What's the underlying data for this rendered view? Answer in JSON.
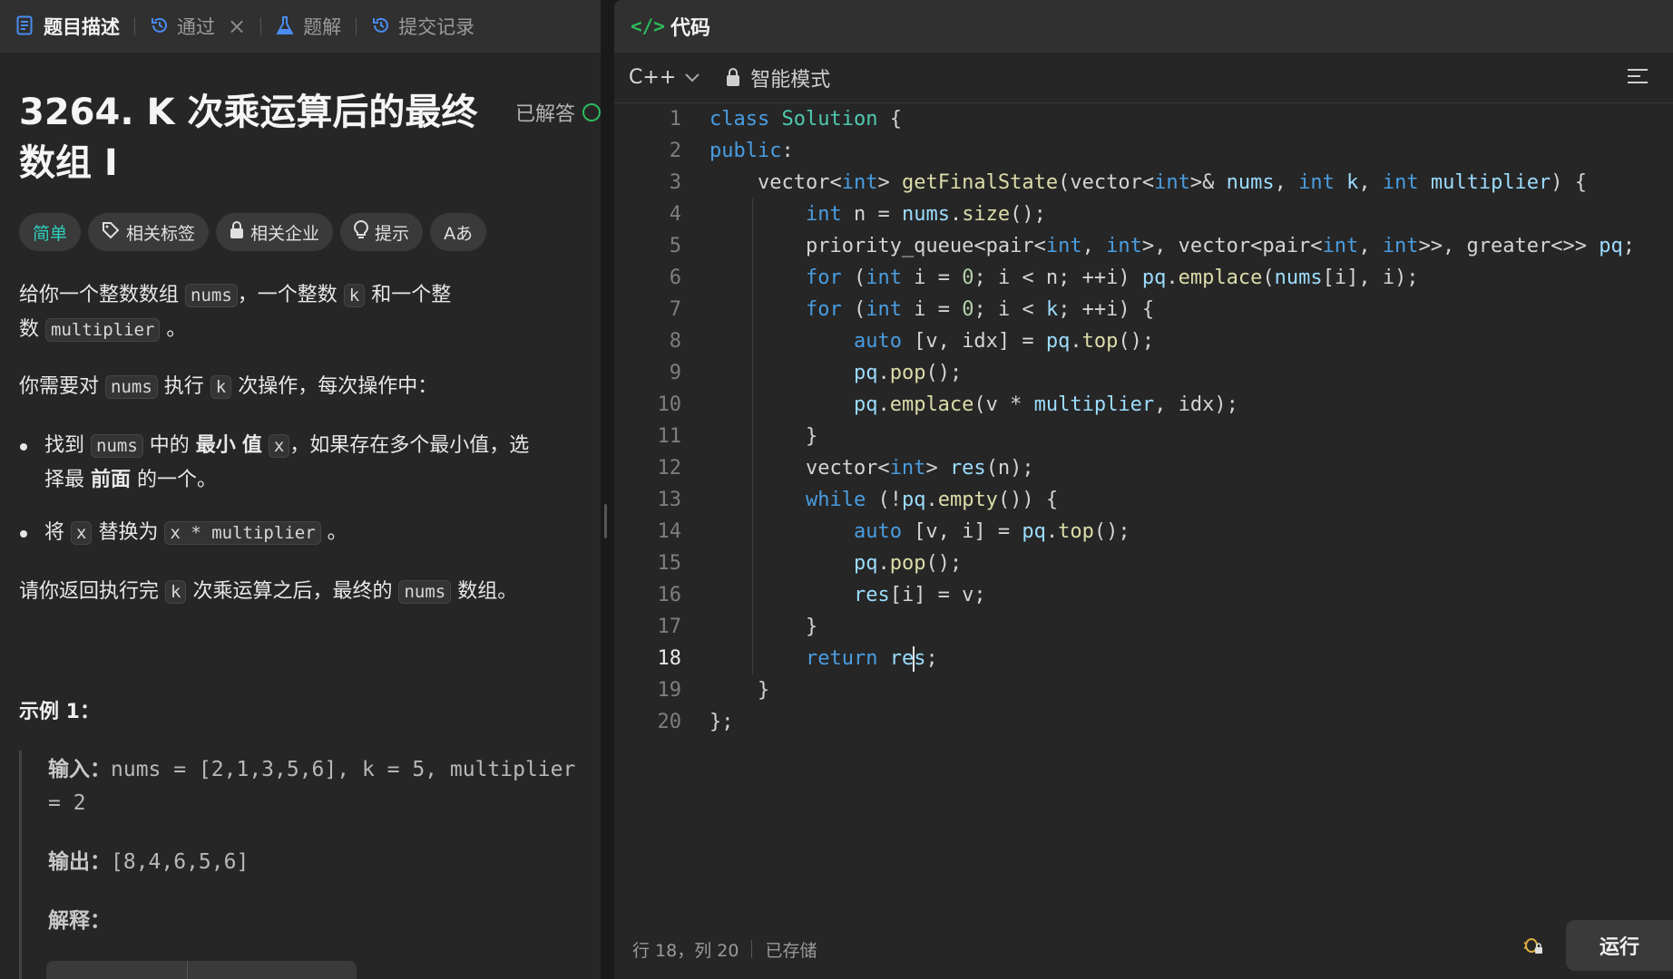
{
  "left_tabs": [
    {
      "label": "题目描述",
      "icon": "document-icon",
      "active": true
    },
    {
      "label": "通过",
      "icon": "history-icon",
      "closable": true
    },
    {
      "label": "题解",
      "icon": "flask-icon"
    },
    {
      "label": "提交记录",
      "icon": "history-icon"
    }
  ],
  "problem": {
    "title": "3264. K 次乘运算后的最终数组 I",
    "solved_label": "已解答",
    "tags": {
      "difficulty": "简单",
      "related_tags": "相关标签",
      "related_companies": "相关企业",
      "hint": "提示",
      "font_toggle": "Aあ"
    },
    "desc": {
      "p1_a": "给你一个整数数组",
      "p1_nums": "nums",
      "p1_b": "，一个整数",
      "p1_k": "k",
      "p1_c": "和一个整",
      "p1_d": "数",
      "p1_mult": "multiplier",
      "p1_e": "。",
      "p2_a": "你需要对",
      "p2_nums": "nums",
      "p2_b": "执行",
      "p2_k": "k",
      "p2_c": "次操作，每次操作中：",
      "b1_a": "找到",
      "b1_nums": "nums",
      "b1_b": "中的",
      "b1_bold1": "最小",
      "b1_bold2": "值",
      "b1_x": "x",
      "b1_c": "，如果存在多个最小值，选",
      "b1_d": "择最",
      "b1_bold3": "前面",
      "b1_e": "的一个。",
      "b2_a": "将",
      "b2_x": "x",
      "b2_b": "替换为",
      "b2_expr": "x * multiplier",
      "b2_c": "。",
      "p3_a": "请你返回执行完",
      "p3_k": "k",
      "p3_b": "次乘运算之后，最终的",
      "p3_nums": "nums",
      "p3_c": "数组。"
    },
    "example": {
      "title": "示例 1：",
      "input_label": "输入：",
      "input_value": "nums = [2,1,3,5,6], k = 5, multiplier",
      "input_cont": "= 2",
      "output_label": "输出：",
      "output_value": "[8,4,6,5,6]",
      "explain_label": "解释："
    }
  },
  "editor": {
    "tab_label": "代码",
    "language": "C++",
    "mode": "智能模式",
    "status_position": "行 18，列 20",
    "status_saved": "已存储",
    "run_label": "运行",
    "current_line": 18,
    "lines": [
      "class Solution {",
      "public:",
      "    vector<int> getFinalState(vector<int>& nums, int k, int multiplier) {",
      "        int n = nums.size();",
      "        priority_queue<pair<int, int>, vector<pair<int, int>>, greater<>> pq;",
      "        for (int i = 0; i < n; ++i) pq.emplace(nums[i], i);",
      "        for (int i = 0; i < k; ++i) {",
      "            auto [v, idx] = pq.top();",
      "            pq.pop();",
      "            pq.emplace(v * multiplier, idx);",
      "        }",
      "        vector<int> res(n);",
      "        while (!pq.empty()) {",
      "            auto [v, i] = pq.top();",
      "            pq.pop();",
      "            res[i] = v;",
      "        }",
      "        return res;",
      "    }",
      "};"
    ]
  }
}
